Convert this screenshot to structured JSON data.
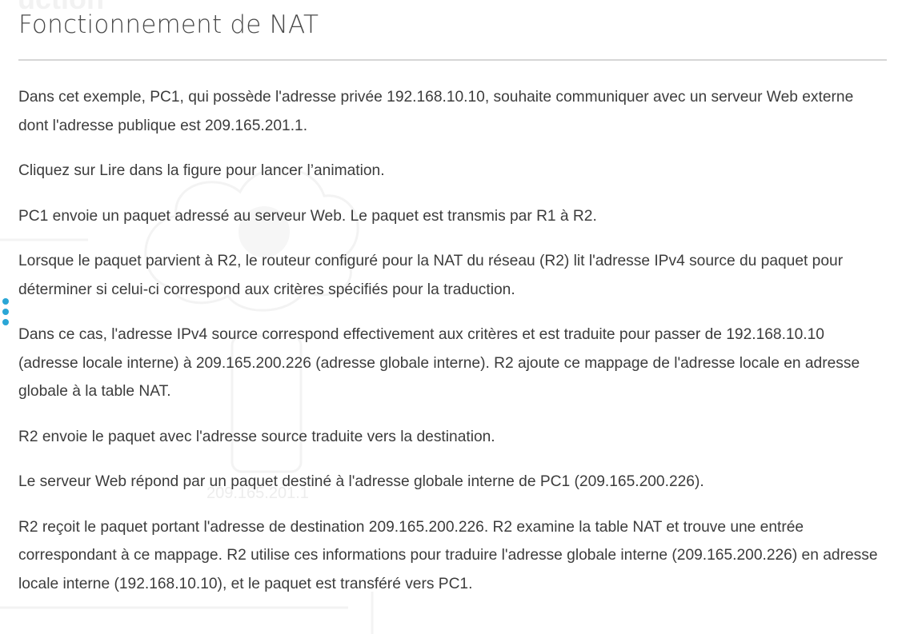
{
  "header": {
    "title": "Fonctionnement de NAT"
  },
  "background": {
    "faint_heading": "uction",
    "faint_ip": "209.165.201.1"
  },
  "body": {
    "paragraphs": [
      "Dans cet exemple, PC1, qui possède l'adresse privée 192.168.10.10, souhaite communiquer avec un serveur Web externe dont l'adresse publique est 209.165.201.1.",
      "Cliquez sur Lire dans la figure pour lancer l’animation.",
      "PC1 envoie un paquet adressé au serveur Web. Le paquet est transmis par R1 à R2.",
      "Lorsque le paquet parvient à R2, le routeur configuré pour la NAT du réseau (R2) lit l'adresse IPv4 source du paquet pour déterminer si celui-ci correspond aux critères spécifiés pour la traduction.",
      "Dans ce cas, l'adresse IPv4 source correspond effectivement aux critères et est traduite pour passer de 192.168.10.10 (adresse locale interne) à 209.165.200.226 (adresse globale interne). R2 ajoute ce mappage de l'adresse locale en adresse globale à la table NAT.",
      "R2 envoie le paquet avec l'adresse source traduite vers la destination.",
      "Le serveur Web répond par un paquet destiné à l'adresse globale interne de PC1 (209.165.200.226).",
      "R2 reçoit le paquet portant l'adresse de destination 209.165.200.226. R2 examine la table NAT et trouve une entrée correspondant à ce mappage. R2 utilise ces informations pour traduire l'adresse globale interne (209.165.200.226) en adresse locale interne (192.168.10.10), et le paquet est transféré vers PC1."
    ]
  },
  "side_handle": {
    "icon": "vertical-dots-icon",
    "color": "#2aa6d6"
  }
}
